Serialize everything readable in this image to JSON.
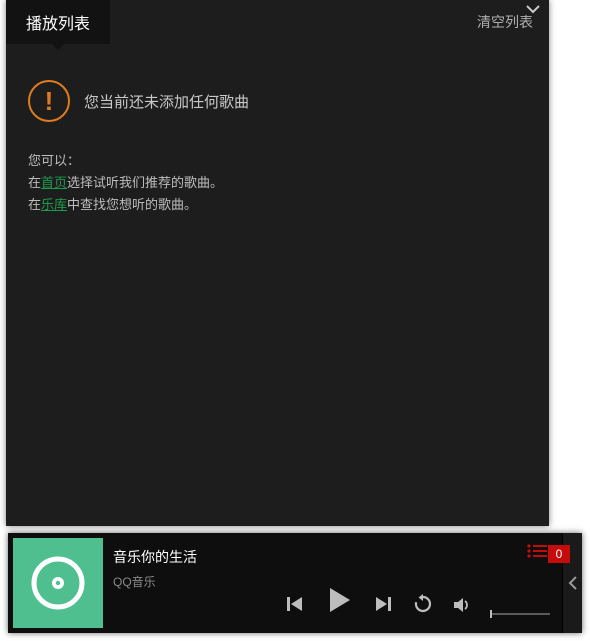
{
  "panel": {
    "tab_label": "播放列表",
    "clear_label": "清空列表"
  },
  "empty": {
    "warning": "您当前还未添加任何歌曲",
    "hint_intro": "您可以：",
    "line1_pre": "在",
    "line1_link": "首页",
    "line1_post": "选择试听我们推荐的歌曲。",
    "line2_pre": "在",
    "line2_link": "乐库",
    "line2_post": "中查找您想听的歌曲。"
  },
  "player": {
    "title": "音乐你的生活",
    "artist": "QQ音乐",
    "queue_count": "0"
  }
}
